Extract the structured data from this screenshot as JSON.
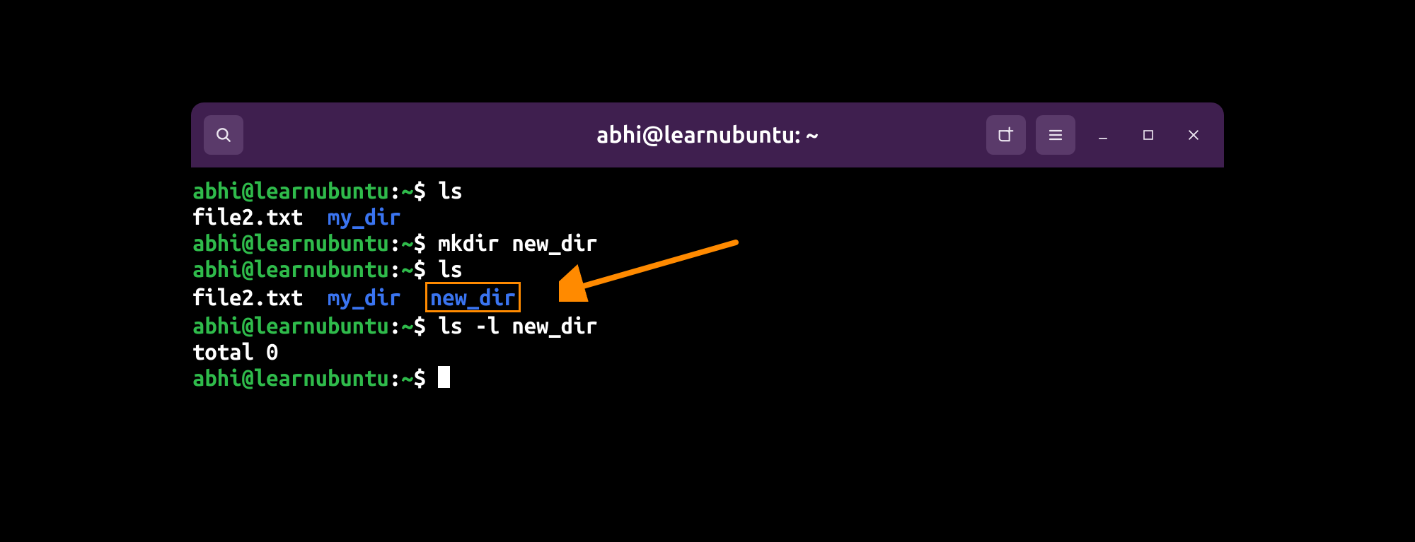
{
  "window": {
    "title": "abhi@learnubuntu: ~"
  },
  "prompt": {
    "user_host": "abhi@learnubuntu",
    "path": "~",
    "sep": ":",
    "symbol": "$"
  },
  "lines": {
    "cmd1": "ls",
    "ls1_file": "file2.txt",
    "ls1_dir": "my_dir",
    "cmd2": "mkdir new_dir",
    "cmd3": "ls",
    "ls2_file": "file2.txt",
    "ls2_dir1": "my_dir",
    "ls2_dir2": "new_dir",
    "cmd4": "ls -l new_dir",
    "output4": "total 0"
  },
  "colors": {
    "titlebar": "#3f1f4f",
    "prompt_green": "#2fbb4b",
    "dir_blue": "#3a74f0",
    "highlight_orange": "#ff8a00"
  },
  "icons": {
    "search": "search-icon",
    "new_tab": "new-tab-icon",
    "menu": "hamburger-menu-icon",
    "minimize": "minimize-icon",
    "maximize": "maximize-icon",
    "close": "close-icon"
  }
}
